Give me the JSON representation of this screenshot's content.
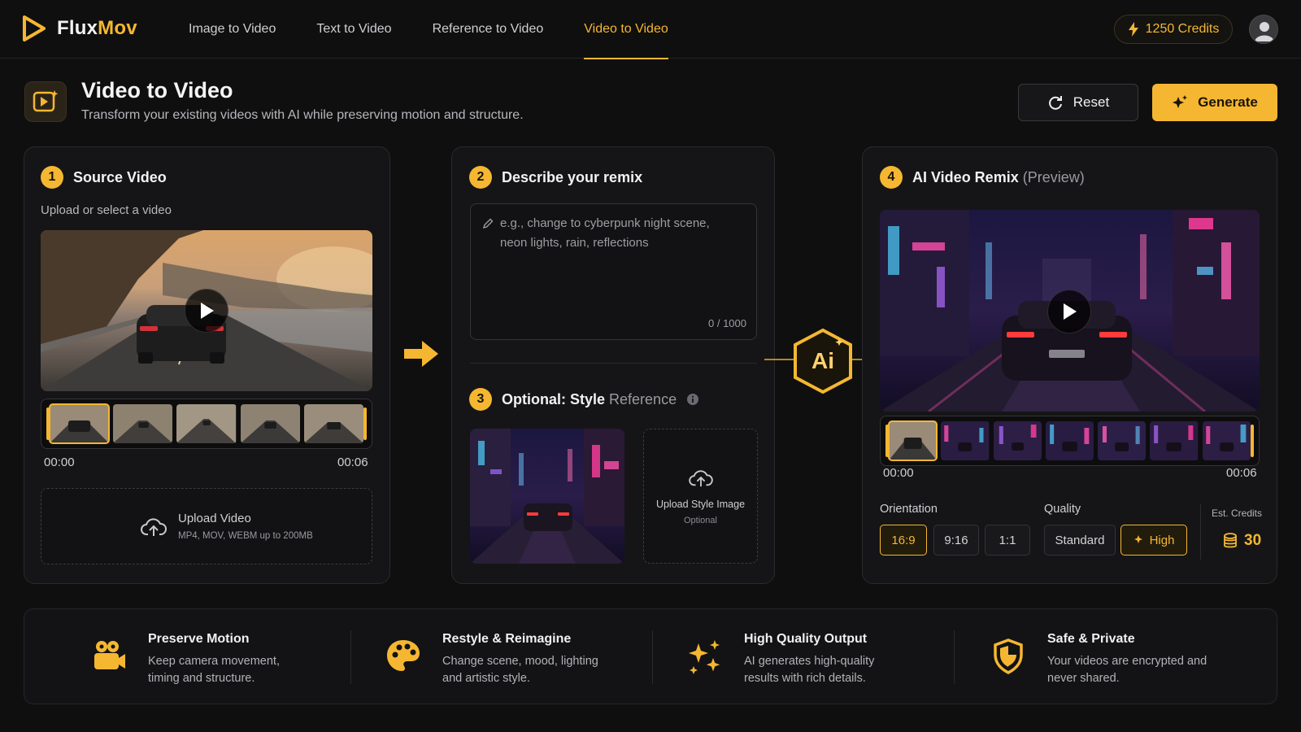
{
  "brand": {
    "name_a": "Flux",
    "name_b": "Mov"
  },
  "nav": {
    "items": [
      {
        "label": "Image to Video"
      },
      {
        "label": "Text to Video"
      },
      {
        "label": "Reference to Video"
      },
      {
        "label": "Video to Video"
      }
    ],
    "active": "Video to Video"
  },
  "account": {
    "credits": "1250 Credits"
  },
  "header": {
    "title": "Video to Video",
    "subtitle": "Transform your existing videos with AI while preserving motion and structure.",
    "reset_label": "Reset",
    "generate_label": "Generate"
  },
  "source": {
    "step": "1",
    "title": "Source Video",
    "hint": "Upload or select a video",
    "time_start": "00:00",
    "time_end": "00:06",
    "upload_title": "Upload Video",
    "upload_formats": "MP4, MOV, WEBM up to 200MB"
  },
  "prompt": {
    "step": "2",
    "title": "Describe your remix",
    "placeholder": "e.g., change to cyberpunk night scene, neon lights, rain, reflections",
    "counter": "0 / 1000"
  },
  "style": {
    "step": "3",
    "title_a": "Optional: Style",
    "title_b": "Reference",
    "upload_title": "Upload Style Image",
    "upload_note": "Optional"
  },
  "ai_badge": "Ai",
  "result": {
    "step": "4",
    "title": "AI Video Remix",
    "title_note": "(Preview)",
    "time_start": "00:00",
    "time_end": "00:06",
    "orientation_label": "Orientation",
    "orientations": [
      "16:9",
      "9:16",
      "1:1"
    ],
    "orientation_selected": "16:9",
    "quality_label": "Quality",
    "qualities": [
      "Standard",
      "High"
    ],
    "quality_selected": "High",
    "est_label": "Est. Credits",
    "est_value": "30"
  },
  "features": [
    {
      "icon": "camera-icon",
      "title": "Preserve Motion",
      "desc": "Keep camera movement, timing and structure."
    },
    {
      "icon": "palette-icon",
      "title": "Restyle & Reimagine",
      "desc": "Change scene, mood, lighting and artistic style."
    },
    {
      "icon": "sparkles-icon",
      "title": "High Quality Output",
      "desc": "AI generates high-quality results with rich details."
    },
    {
      "icon": "shield-icon",
      "title": "Safe & Private",
      "desc": "Your videos are encrypted and never shared."
    }
  ],
  "colors": {
    "accent": "#f5b731",
    "background": "#0f0f10",
    "panel": "#151517"
  }
}
